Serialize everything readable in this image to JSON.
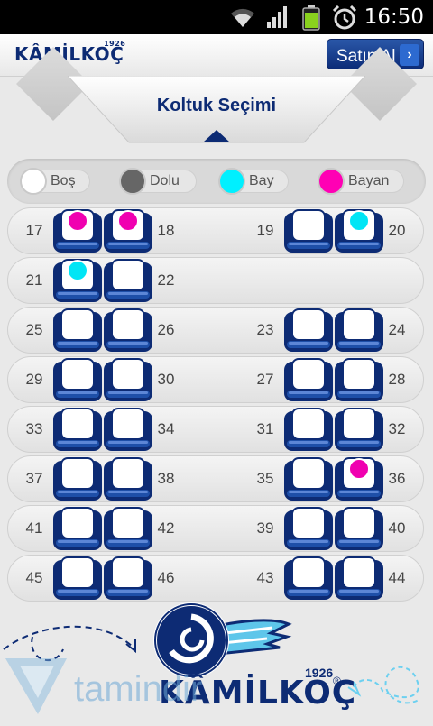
{
  "status_bar": {
    "time": "16:50"
  },
  "header": {
    "logo_text": "KÂMİLKOÇ",
    "logo_year": "1926",
    "buy_button_label": "Satın Al",
    "buy_button_chevron": "›"
  },
  "title": "Koltuk Seçimi",
  "legend": [
    {
      "label": "Boş",
      "color": "#ffffff"
    },
    {
      "label": "Dolu",
      "color": "#666666"
    },
    {
      "label": "Bay",
      "color": "#00f0ff"
    },
    {
      "label": "Bayan",
      "color": "#ff00b4"
    }
  ],
  "colors": {
    "brand_navy": "#0d2b74",
    "male": "#00e5f5",
    "female": "#f000b0"
  },
  "rows": [
    {
      "left": [
        {
          "num": "17",
          "occ": "female"
        },
        {
          "num": "18",
          "occ": "female"
        }
      ],
      "right": [
        {
          "num": "19",
          "occ": "empty"
        },
        {
          "num": "20",
          "occ": "male"
        }
      ]
    },
    {
      "left": [
        {
          "num": "21",
          "occ": "male"
        },
        {
          "num": "22",
          "occ": "empty"
        }
      ],
      "right": []
    },
    {
      "left": [
        {
          "num": "25",
          "occ": "empty"
        },
        {
          "num": "26",
          "occ": "empty"
        }
      ],
      "right": [
        {
          "num": "23",
          "occ": "empty"
        },
        {
          "num": "24",
          "occ": "empty"
        }
      ]
    },
    {
      "left": [
        {
          "num": "29",
          "occ": "empty"
        },
        {
          "num": "30",
          "occ": "empty"
        }
      ],
      "right": [
        {
          "num": "27",
          "occ": "empty"
        },
        {
          "num": "28",
          "occ": "empty"
        }
      ]
    },
    {
      "left": [
        {
          "num": "33",
          "occ": "empty"
        },
        {
          "num": "34",
          "occ": "empty"
        }
      ],
      "right": [
        {
          "num": "31",
          "occ": "empty"
        },
        {
          "num": "32",
          "occ": "empty"
        }
      ]
    },
    {
      "left": [
        {
          "num": "37",
          "occ": "empty"
        },
        {
          "num": "38",
          "occ": "empty"
        }
      ],
      "right": [
        {
          "num": "35",
          "occ": "empty"
        },
        {
          "num": "36",
          "occ": "female"
        }
      ]
    },
    {
      "left": [
        {
          "num": "41",
          "occ": "empty"
        },
        {
          "num": "42",
          "occ": "empty"
        }
      ],
      "right": [
        {
          "num": "39",
          "occ": "empty"
        },
        {
          "num": "40",
          "occ": "empty"
        }
      ]
    },
    {
      "left": [
        {
          "num": "45",
          "occ": "empty"
        },
        {
          "num": "46",
          "occ": "empty"
        }
      ],
      "right": [
        {
          "num": "43",
          "occ": "empty"
        },
        {
          "num": "44",
          "occ": "empty"
        }
      ]
    }
  ],
  "footer": {
    "brand_name": "KÂMİLKOÇ",
    "brand_year": "1926",
    "brand_reg": "®",
    "watermark": "tamindir"
  }
}
